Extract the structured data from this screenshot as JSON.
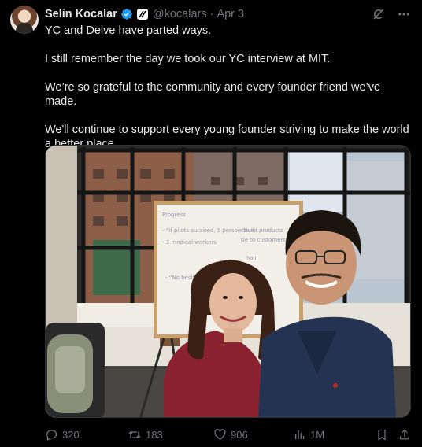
{
  "author": {
    "name": "Selin Kocalar",
    "handle": "@kocalars",
    "date": "Apr 3"
  },
  "post": {
    "paragraphs": [
      "YC and Delve have parted ways.",
      "I still remember the day we took our YC interview at MIT.",
      "We’re so grateful to the community and every founder friend we’ve made.",
      "We'll continue to support every young founder striving to make the world a better place."
    ]
  },
  "photo": {
    "whiteboard_lines": [
      "Progress",
      "- “if pilots succeed, 1 perspective",
      "- 3 medical workers",
      "“build products",
      "tie to customers",
      "hair",
      "- “No hesitation speed increase”"
    ]
  },
  "stats": {
    "replies": "320",
    "reposts": "183",
    "likes": "906",
    "views": "1M"
  },
  "colors": {
    "background": "#000000",
    "text": "#e7e9ea",
    "muted": "#71767b",
    "verified": "#1d9bf0"
  }
}
